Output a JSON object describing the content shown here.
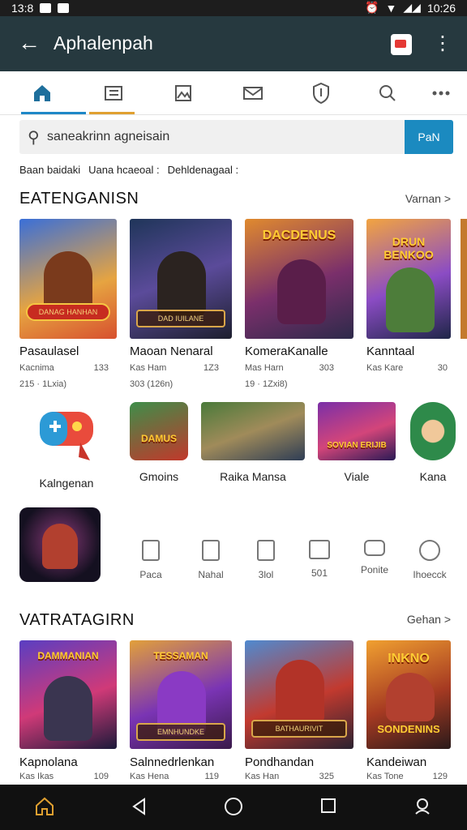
{
  "status_bar": {
    "time_left": "13:8",
    "time_right": "10:26"
  },
  "app_bar": {
    "title": "Aphalenpah"
  },
  "tabs": [
    {
      "icon": "home-icon"
    },
    {
      "icon": "list-icon"
    },
    {
      "icon": "image-icon"
    },
    {
      "icon": "mail-icon"
    },
    {
      "icon": "badge-icon"
    },
    {
      "icon": "search-icon"
    },
    {
      "icon": "more-icon"
    }
  ],
  "search": {
    "value": "saneakrinn agneisain",
    "button_label": "PaN"
  },
  "chips": [
    "Baan baidaki",
    "Uana hcaeoal :",
    "Dehldenagaal :"
  ],
  "section1": {
    "title": "EATENGANISN",
    "link": "Varnan >",
    "cards": [
      {
        "name": "Pasaulasel",
        "meta1": "Kacnima",
        "meta2": "133",
        "meta3": "215 · 1Lxia)",
        "banner_top": "",
        "banner_label": "DANAG\nHANHAN"
      },
      {
        "name": "Maoan Nenaral",
        "meta1": "Kas Ham",
        "meta2": "1Z3",
        "meta3": "303 (126n)",
        "banner_top": "",
        "banner_label": "DAD IUILANE"
      },
      {
        "name": "KomeraKanalle",
        "meta1": "Mas Harn",
        "meta2": "303",
        "meta3": "19 · 1Zxi8)",
        "banner_top": "DACDENUS",
        "banner_label": ""
      },
      {
        "name": "Kanntaal",
        "meta1": "Kas Kare",
        "meta2": "30",
        "meta3": "",
        "banner_top": "DRUN BENKOO",
        "banner_label": ""
      }
    ]
  },
  "categories": [
    {
      "label": "Kalngenan"
    },
    {
      "label": "Gmoins",
      "art_text": "DAMUS"
    },
    {
      "label": "Raika Mansa"
    },
    {
      "label": "Viale",
      "art_text": "SOVIAN ERIJIB"
    },
    {
      "label": "Kana"
    }
  ],
  "utilities": [
    {
      "label": "Paca"
    },
    {
      "label": "Nahal"
    },
    {
      "label": "3lol"
    },
    {
      "label": "501"
    },
    {
      "label": "Ponite"
    },
    {
      "label": "Ihoecck"
    }
  ],
  "section2": {
    "title": "VATRATAGIRN",
    "link": "Gehan >",
    "cards": [
      {
        "name": "Kapnolana",
        "meta1": "Kas Ikas",
        "meta2": "109",
        "banner_top": "DAMMANIAN",
        "banner_label": ""
      },
      {
        "name": "Salnnedrlenkan",
        "meta1": "Kas Hena",
        "meta2": "119",
        "banner_top": "TESSAMAN",
        "banner_label": "EMNHUNDKE"
      },
      {
        "name": "Pondhandan",
        "meta1": "Kas Han",
        "meta2": "325",
        "banner_top": "",
        "banner_label": "BATHAURIVIT"
      },
      {
        "name": "Kandeiwan",
        "meta1": "Kas Tone",
        "meta2": "129",
        "banner_top": "INKNO",
        "banner_label": "SONDENINS"
      }
    ]
  },
  "colors": {
    "app_bar": "#26393f",
    "accent": "#1b8ac0",
    "nav_bar": "#111111"
  }
}
